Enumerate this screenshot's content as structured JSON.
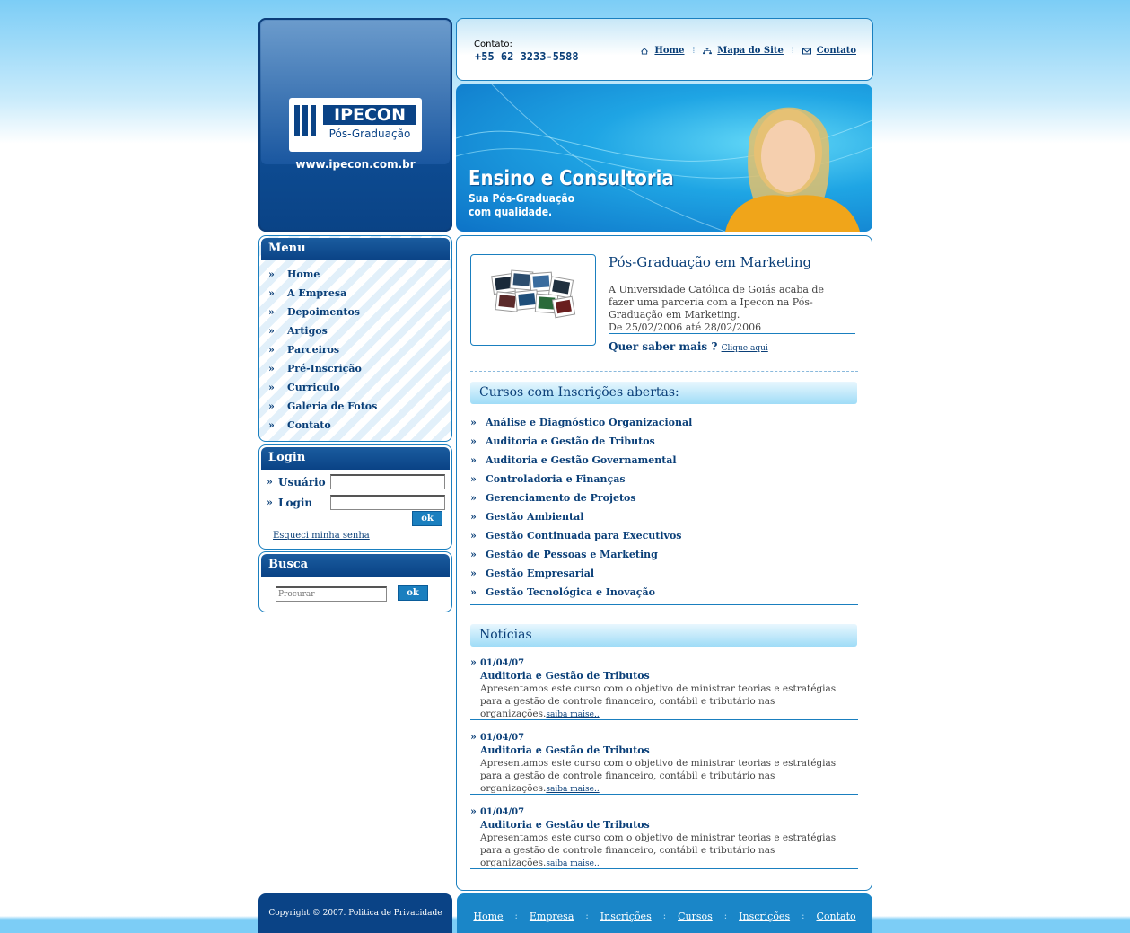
{
  "logo": {
    "name": "IPECON",
    "subtitle": "Pós-Graduação",
    "url": "www.ipecon.com.br"
  },
  "header": {
    "contact_label": "Contato:",
    "phone": "+55 62 3233-5588",
    "links": [
      "Home",
      "Mapa do Site",
      "Contato"
    ]
  },
  "banner": {
    "title": "Ensino e Consultoria",
    "subtitle": "Sua Pós-Graduação com qualidade."
  },
  "menu": {
    "title": "Menu",
    "items": [
      "Home",
      "A Empresa",
      "Depoimentos",
      "Artigos",
      "Parceiros",
      "Pré-Inscrição",
      "Curriculo",
      "Galeria de Fotos",
      "Contato"
    ]
  },
  "login": {
    "title": "Login",
    "user_label": "Usuário",
    "login_label": "Login",
    "ok_label": "ok",
    "forgot": "Esqueci minha senha"
  },
  "search": {
    "title": "Busca",
    "placeholder": "Procurar",
    "ok_label": "ok"
  },
  "feature": {
    "title": "Pós-Graduação em Marketing",
    "description": "A Universidade Católica de Goiás acaba de fazer uma parceria com a Ipecon na Pós-Graduação em Marketing.",
    "dates": "De 25/02/2006 até 28/02/2006",
    "more_label": "Quer saber mais ?",
    "more_link": "Clique aqui"
  },
  "courses": {
    "title": "Cursos com Inscrições abertas:",
    "items": [
      "Análise e Diagnóstico Organizacional",
      "Auditoria e Gestão de Tributos",
      "Auditoria e Gestão Governamental",
      "Controladoria e Finanças",
      "Gerenciamento de Projetos",
      "Gestão Ambiental",
      "Gestão Continuada para Executivos",
      "Gestão de Pessoas e Marketing",
      "Gestão Empresarial",
      "Gestão Tecnológica e Inovação"
    ]
  },
  "news": {
    "title": "Notícias",
    "items": [
      {
        "date": "01/04/07",
        "title": "Auditoria e Gestão de Tributos",
        "text": "Apresentamos este curso com o objetivo de ministrar teorias e estratégias para a gestão de controle financeiro, contábil e tributário nas organizações.",
        "link": "saiba maise.."
      },
      {
        "date": "01/04/07",
        "title": "Auditoria e Gestão de Tributos",
        "text": "Apresentamos este curso com o objetivo de ministrar teorias e estratégias para a gestão de controle financeiro, contábil e tributário nas organizações.",
        "link": "saiba maise.."
      },
      {
        "date": "01/04/07",
        "title": "Auditoria e Gestão de Tributos",
        "text": "Apresentamos este curso com o objetivo de ministrar teorias e estratégias para a gestão de controle financeiro, contábil e tributário nas organizações.",
        "link": "saiba maise.."
      }
    ]
  },
  "footer": {
    "copyright": "Copyright © 2007. Politica de Privacidade",
    "links": [
      "Home",
      "Empresa",
      "Inscrições",
      "Cursos",
      "Inscrições",
      "Contato"
    ],
    "separator": ":"
  },
  "colors": {
    "navy": "#0a4386",
    "accent": "#1a7fbf",
    "sky": "#7ccdf6"
  }
}
